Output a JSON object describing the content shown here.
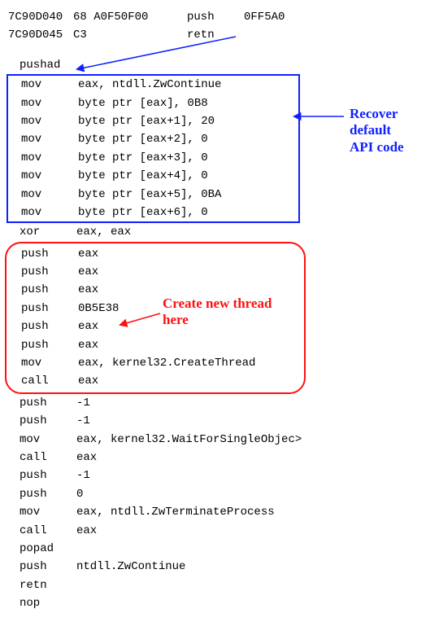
{
  "header": [
    {
      "addr": "7C90D040",
      "hex": "68 A0F50F00",
      "mnem": "push",
      "op": "0FF5A0"
    },
    {
      "addr": "7C90D045",
      "hex": "C3",
      "mnem": "retn",
      "op": ""
    }
  ],
  "after_header": [
    {
      "mnem": "pushad",
      "op": ""
    }
  ],
  "blue_block": [
    {
      "mnem": "mov",
      "op": "eax, ntdll.ZwContinue"
    },
    {
      "mnem": "mov",
      "op": "byte ptr [eax], 0B8"
    },
    {
      "mnem": "mov",
      "op": "byte ptr [eax+1], 20"
    },
    {
      "mnem": "mov",
      "op": "byte ptr [eax+2], 0"
    },
    {
      "mnem": "mov",
      "op": "byte ptr [eax+3], 0"
    },
    {
      "mnem": "mov",
      "op": "byte ptr [eax+4], 0"
    },
    {
      "mnem": "mov",
      "op": "byte ptr [eax+5], 0BA"
    },
    {
      "mnem": "mov",
      "op": "byte ptr [eax+6], 0"
    }
  ],
  "mid1": [
    {
      "mnem": "xor",
      "op": "eax, eax"
    }
  ],
  "red_block": [
    {
      "mnem": "push",
      "op": "eax"
    },
    {
      "mnem": "push",
      "op": "eax"
    },
    {
      "mnem": "push",
      "op": "eax"
    },
    {
      "mnem": "push",
      "op": "0B5E38"
    },
    {
      "mnem": "push",
      "op": "eax"
    },
    {
      "mnem": "push",
      "op": "eax"
    },
    {
      "mnem": "mov",
      "op": "eax, kernel32.CreateThread"
    },
    {
      "mnem": "call",
      "op": "eax"
    }
  ],
  "tail": [
    {
      "mnem": "push",
      "op": "-1"
    },
    {
      "mnem": "push",
      "op": "-1"
    },
    {
      "mnem": "mov",
      "op": "eax, kernel32.WaitForSingleObjec>"
    },
    {
      "mnem": "call",
      "op": "eax"
    },
    {
      "mnem": "push",
      "op": "-1"
    },
    {
      "mnem": "push",
      "op": "0"
    },
    {
      "mnem": "mov",
      "op": "eax, ntdll.ZwTerminateProcess"
    },
    {
      "mnem": "call",
      "op": "eax"
    },
    {
      "mnem": "popad",
      "op": ""
    },
    {
      "mnem": "push",
      "op": "ntdll.ZwContinue"
    },
    {
      "mnem": "retn",
      "op": ""
    },
    {
      "mnem": "nop",
      "op": ""
    }
  ],
  "annotations": {
    "blue_label_1": "Recover",
    "blue_label_2": "default",
    "blue_label_3": "API code",
    "red_label_1": "Create new thread",
    "red_label_2": "here"
  }
}
